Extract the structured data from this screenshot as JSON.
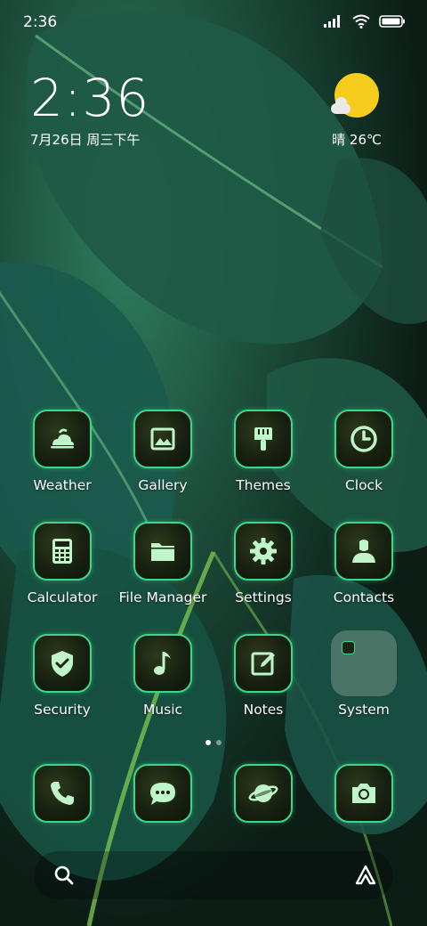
{
  "status_bar": {
    "time": "2:36"
  },
  "clock_widget": {
    "time": "2:36",
    "date": "7月26日 周三下午"
  },
  "weather_widget": {
    "text": "晴 26℃"
  },
  "apps": [
    {
      "label": "Weather",
      "icon": "weather-icon"
    },
    {
      "label": "Gallery",
      "icon": "gallery-icon"
    },
    {
      "label": "Themes",
      "icon": "themes-icon"
    },
    {
      "label": "Clock",
      "icon": "clock-icon"
    },
    {
      "label": "Calculator",
      "icon": "calculator-icon"
    },
    {
      "label": "File Manager",
      "icon": "folder-icon"
    },
    {
      "label": "Settings",
      "icon": "gear-icon"
    },
    {
      "label": "Contacts",
      "icon": "contact-icon"
    },
    {
      "label": "Security",
      "icon": "shield-icon"
    },
    {
      "label": "Music",
      "icon": "music-note-icon"
    },
    {
      "label": "Notes",
      "icon": "notes-icon"
    },
    {
      "label": "System",
      "icon": "folder-icon"
    }
  ],
  "dock": [
    {
      "icon": "phone-icon"
    },
    {
      "icon": "message-icon"
    },
    {
      "icon": "browser-icon"
    },
    {
      "icon": "camera-icon"
    }
  ],
  "page_indicator": {
    "pages": 2,
    "active": 1
  },
  "colors": {
    "accent": "#3fd68a",
    "icon_glyph": "#bff5c8",
    "sun": "#f7cd1d"
  }
}
